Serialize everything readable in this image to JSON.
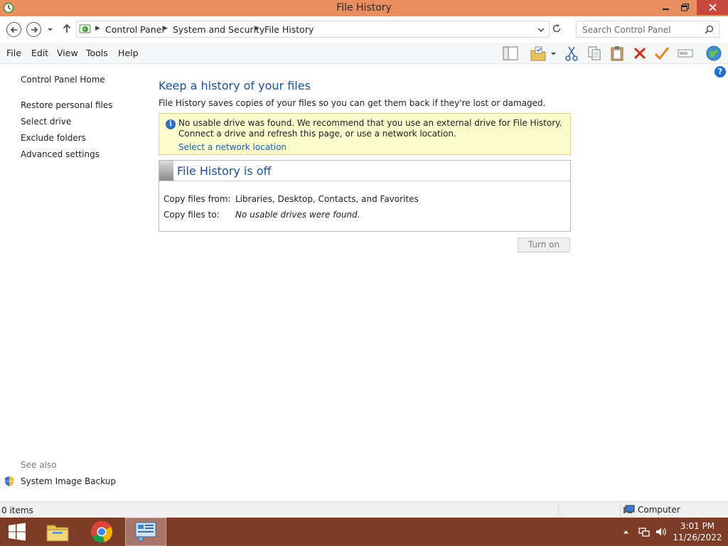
{
  "window": {
    "title": "File History"
  },
  "address": {
    "crumbs": [
      "Control Panel",
      "System and Security",
      "File History"
    ],
    "search_placeholder": "Search Control Panel"
  },
  "menu": [
    "File",
    "Edit",
    "View",
    "Tools",
    "Help"
  ],
  "left_pane": {
    "home": "Control Panel Home",
    "links": [
      "Restore personal files",
      "Select drive",
      "Exclude folders",
      "Advanced settings"
    ],
    "see_also": "See also",
    "system_image_backup": "System Image Backup"
  },
  "main": {
    "title": "Keep a history of your files",
    "description": "File History saves copies of your files so you can get them back if they're lost or damaged.",
    "warning": {
      "message": "No usable drive was found. We recommend that you use an external drive for File History. Connect a drive and refresh this page, or use a network location.",
      "link": "Select a network location"
    },
    "status": {
      "title": "File History is off",
      "copy_from_label": "Copy files from:",
      "copy_from_value": "Libraries, Desktop, Contacts, and Favorites",
      "copy_to_label": "Copy files to:",
      "copy_to_value": "No usable drives were found."
    },
    "turn_on": "Turn on"
  },
  "statusbar": {
    "items": "0 items",
    "location": "Computer"
  },
  "clock": {
    "time": "3:01 PM",
    "date": "11/26/2022"
  },
  "colors": {
    "titlebar": "#e98e5f",
    "taskbar": "#7d3c27",
    "link": "#1e63b4",
    "heading": "#1e4f96",
    "warning_bg": "#fbfbce"
  }
}
